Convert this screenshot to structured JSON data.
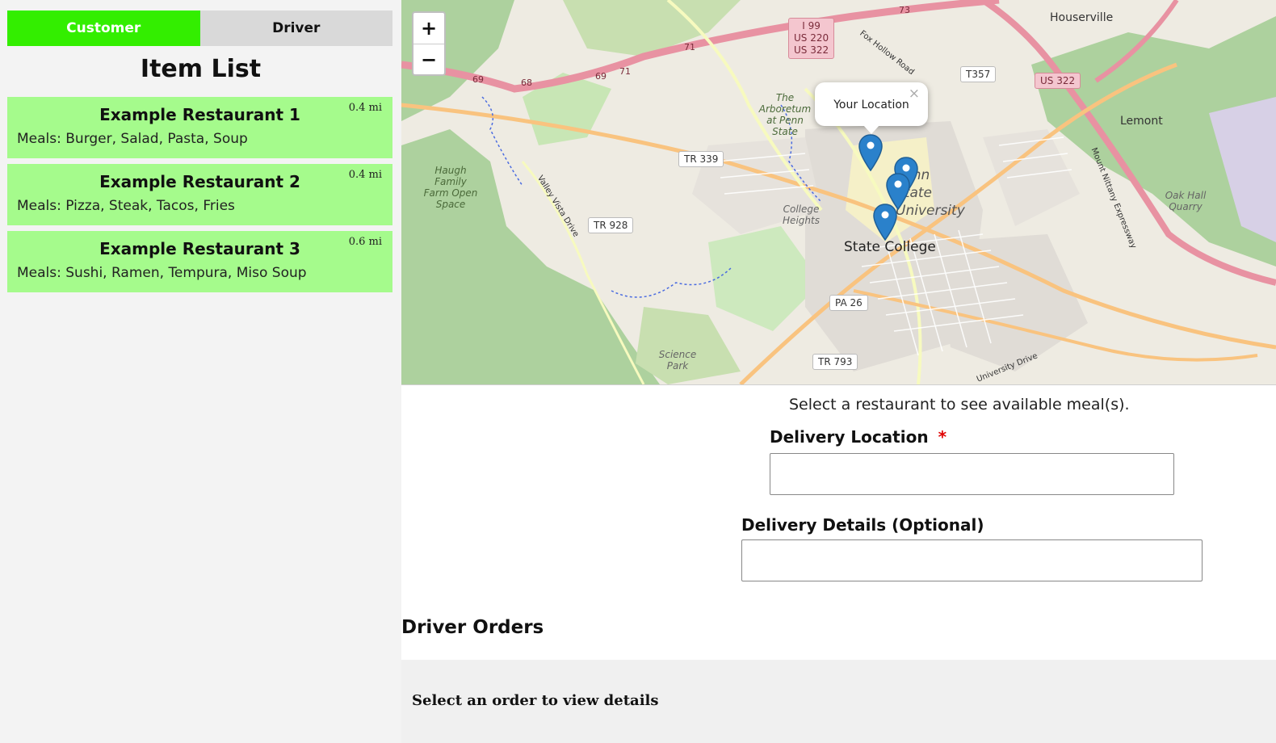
{
  "tabs": {
    "customer": "Customer",
    "driver": "Driver",
    "active": "customer"
  },
  "item_list": {
    "title": "Item List",
    "items": [
      {
        "name": "Example Restaurant 1",
        "distance": "0.4 mi",
        "meals": "Meals: Burger, Salad, Pasta, Soup"
      },
      {
        "name": "Example Restaurant 2",
        "distance": "0.4 mi",
        "meals": "Meals: Pizza, Steak, Tacos, Fries"
      },
      {
        "name": "Example Restaurant 3",
        "distance": "0.6 mi",
        "meals": "Meals: Sushi, Ramen, Tempura, Miso Soup"
      }
    ]
  },
  "map": {
    "zoom_in": "+",
    "zoom_out": "−",
    "popup_text": "Your Location",
    "popup_close": "×",
    "places": {
      "houserville": "Houserville",
      "lemont": "Lemont",
      "state_college": "State College",
      "penn_state": "Penn State University",
      "arboretum": "The Arboretum at Penn State",
      "haugh": "Haugh Family Farm Open Space",
      "college_heights": "College Heights",
      "science_park": "Science Park",
      "oak_hall": "Oak Hall Quarry",
      "fox_hollow": "Fox Hollow Road",
      "valley_vista": "Valley Vista Drive",
      "mount_nittany": "Mount Nittany Expressway",
      "university_drive": "University Drive"
    },
    "shields": {
      "i99": "I 99",
      "us220": "US 220",
      "us322_a": "US 322",
      "us322_b": "US 322",
      "t357": "T357",
      "tr339": "TR 339",
      "tr928": "TR 928",
      "pa26": "PA 26",
      "tr793": "TR 793"
    },
    "route_numbers": {
      "r73": "73",
      "r71": "71",
      "r69": "69",
      "r68": "68",
      "r69b": "69",
      "r71b": "71"
    },
    "colors": {
      "motorway": "#e892a2",
      "primary": "#f9c37f",
      "forest": "#add19e",
      "marker": "#2a81cb"
    }
  },
  "form": {
    "instruction": "Select a restaurant to see available meal(s).",
    "delivery_location_label": "Delivery Location",
    "required_mark": "*",
    "delivery_location_value": "",
    "delivery_details_label": "Delivery Details (Optional)",
    "delivery_details_value": ""
  },
  "driver_orders": {
    "title": "Driver Orders",
    "empty_text": "Select an order to view details"
  },
  "colors": {
    "accent_green": "#33ee00",
    "card_green": "#a5fb8c",
    "sidebar_bg": "#f3f3f3"
  }
}
